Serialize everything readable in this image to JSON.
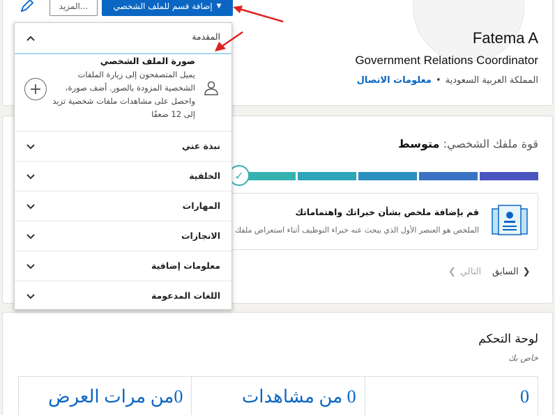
{
  "profile": {
    "name": "Fatema A",
    "headline": "Government Relations Coordinator",
    "location": "المملكة العربية السعودية",
    "separator": "•",
    "contact_link": "معلومات الاتصال"
  },
  "toolbar": {
    "add_section_label": "إضافة قسم للملف الشخصي",
    "more_label": "المزيد..."
  },
  "strength": {
    "label": "قوة ملفك الشخصي:",
    "level": "متوسط",
    "progress_segments_filled": 5,
    "suggestion_title": "قم بإضافة ملخص بشأن خبراتك واهتماماتك",
    "suggestion_desc": "الملخص هو العنصر الأول الذي يبحث عنه خبراء التوظيف أثناء استعراض ملفك الشخصي",
    "prev_label": "السابق",
    "next_label": "التالي"
  },
  "dashboard": {
    "title": "لوحة التحكم",
    "private_label": "خاص بك",
    "stats": [
      "0",
      "0 من مشاهدات",
      "0من مرات العرض"
    ]
  },
  "dropdown": {
    "intro_label": "المقدمة",
    "photo_title": "صورة الملف الشخصي",
    "photo_desc": "يميل المتصفحون إلى زيارة الملفات الشخصية المزودة بالصور. أضف صورة، واحصل على مشاهدات ملفات شخصية تزيد إلى 12 ضعفًا",
    "items": [
      "نبذة عني",
      "الخلفية",
      "المهارات",
      "الانجازات",
      "معلومات إضافية",
      "اللغات المدعومة"
    ]
  },
  "colors": {
    "brand": "#0a66c2",
    "progress": [
      "#35b2b0",
      "#2ea5b8",
      "#2b8fc0",
      "#3a73c4",
      "#4a55c0"
    ],
    "annotation": "#e02020"
  }
}
